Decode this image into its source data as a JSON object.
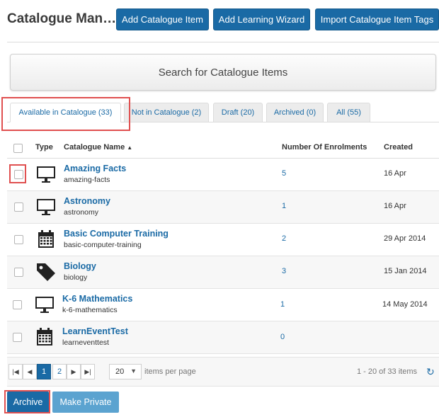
{
  "header": {
    "title": "Catalogue Man…",
    "buttons": [
      "Add Catalogue Item",
      "Add Learning Wizard",
      "Import Catalogue Item Tags"
    ]
  },
  "search": {
    "label": "Search for Catalogue Items"
  },
  "tabs": [
    {
      "label": "Available in Catalogue (33)",
      "active": true
    },
    {
      "label": "Not in Catalogue (2)",
      "active": false
    },
    {
      "label": "Draft (20)",
      "active": false
    },
    {
      "label": "Archived (0)",
      "active": false
    },
    {
      "label": "All (55)",
      "active": false
    }
  ],
  "table": {
    "headers": {
      "type": "Type",
      "name": "Catalogue Name",
      "sort_indicator": "▲",
      "enrolments": "Number Of Enrolments",
      "created": "Created"
    },
    "rows": [
      {
        "icon": "monitor-icon",
        "name": "Amazing Facts",
        "code": "amazing-facts",
        "enrolments": "5",
        "created": "16 Apr"
      },
      {
        "icon": "monitor-icon",
        "name": "Astronomy",
        "code": "astronomy",
        "enrolments": "1",
        "created": "16 Apr"
      },
      {
        "icon": "calendar-icon",
        "name": "Basic Computer Training",
        "code": "basic-computer-training",
        "enrolments": "2",
        "created": "29 Apr 2014"
      },
      {
        "icon": "tag-icon",
        "name": "Biology",
        "code": "biology",
        "enrolments": "3",
        "created": "15 Jan 2014"
      },
      {
        "icon": "monitor-icon",
        "name": "K-6 Mathematics",
        "code": "k-6-mathematics",
        "enrolments": "1",
        "created": "14 May 2014"
      },
      {
        "icon": "calendar-icon",
        "name": "LearnEventTest",
        "code": "learneventtest",
        "enrolments": "0",
        "created": ""
      }
    ]
  },
  "pagination": {
    "first": "|◀",
    "prev": "◀",
    "pages": [
      "1",
      "2"
    ],
    "current_page": "1",
    "next": "▶",
    "last": "▶|",
    "per_page": "20",
    "per_page_caret": "▼",
    "per_page_label": "items per page",
    "range": "1 - 20 of 33 items",
    "refresh": "↻"
  },
  "footer": {
    "archive_label": "Archive",
    "make_private_label": "Make Private"
  },
  "colors": {
    "primary": "#1a6aa5",
    "secondary_button": "#5ba3d0",
    "highlight": "#e05050"
  }
}
